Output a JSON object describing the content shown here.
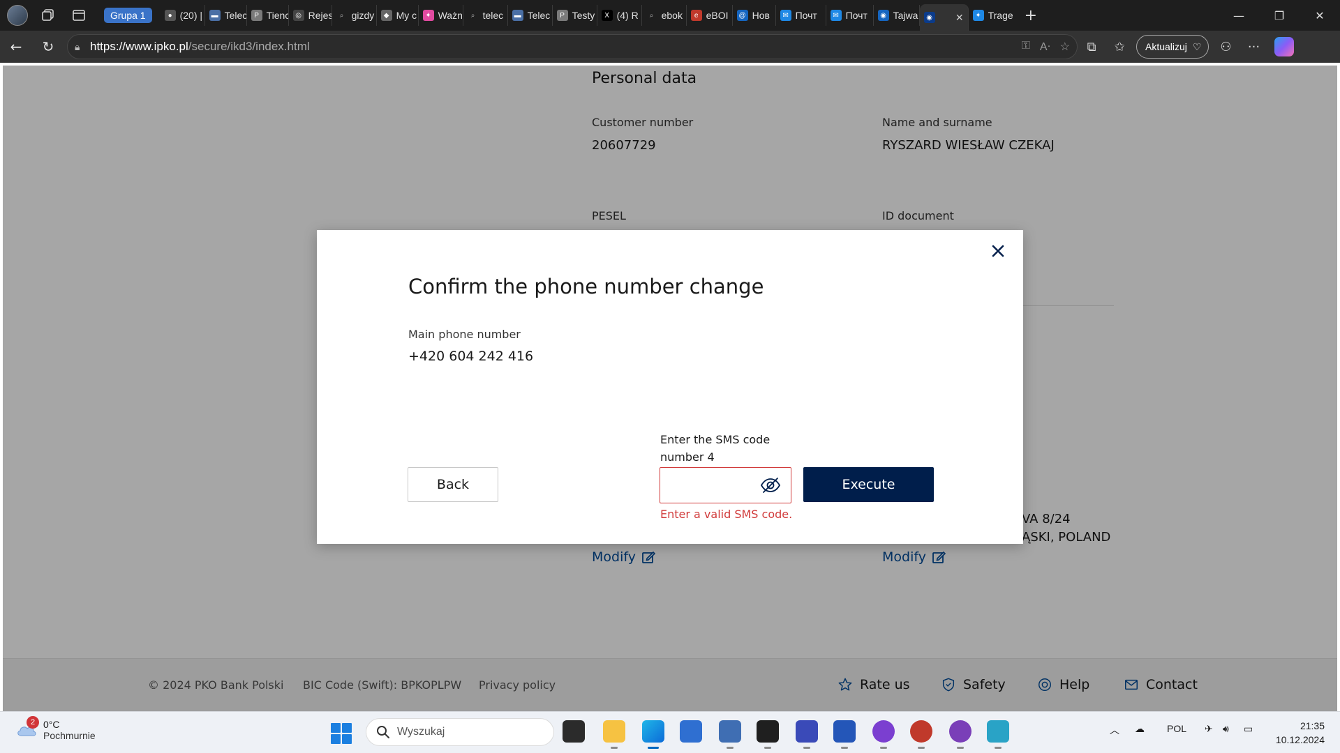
{
  "browser": {
    "profile_icon": "profile-avatar",
    "tab_group_label": "Grupa 1",
    "tabs": [
      {
        "label": "(20) |",
        "icon": "github-icon",
        "color": "#555555"
      },
      {
        "label": "Telec",
        "icon": "telekom-icon",
        "color": "#4a6fa5"
      },
      {
        "label": "Tienc",
        "icon": "p-icon",
        "color": "#7a7a7a"
      },
      {
        "label": "Rejes",
        "icon": "logo-icon",
        "color": "#444444"
      },
      {
        "label": "gizdy",
        "icon": "search-icon",
        "color": "#3a3a3a"
      },
      {
        "label": "My c",
        "icon": "shield-icon",
        "color": "#666666"
      },
      {
        "label": "Ważn",
        "icon": "butterfly-icon",
        "color": "#e14aa0"
      },
      {
        "label": "telec",
        "icon": "search-icon",
        "color": "#3a3a3a"
      },
      {
        "label": "Telec",
        "icon": "telekom-icon",
        "color": "#4a6fa5"
      },
      {
        "label": "Testy",
        "icon": "p-icon",
        "color": "#7a7a7a"
      },
      {
        "label": "(4) R",
        "icon": "x-icon",
        "color": "#000000"
      },
      {
        "label": "ebok",
        "icon": "search-icon",
        "color": "#3a3a3a"
      },
      {
        "label": "eBOI",
        "icon": "orange-swirl-icon",
        "color": "#c0392b"
      },
      {
        "label": "Нов",
        "icon": "at-icon",
        "color": "#1565c0"
      },
      {
        "label": "Почт",
        "icon": "mail-icon",
        "color": "#1e88e5"
      },
      {
        "label": "Почт",
        "icon": "mail-icon",
        "color": "#1e88e5"
      },
      {
        "label": "Tajwa",
        "icon": "pko-icon",
        "color": "#1565c0"
      },
      {
        "label": "",
        "icon": "pko-active-icon",
        "color": "#0b3b8a"
      },
      {
        "label": "Trage",
        "icon": "butterfly-icon",
        "color": "#1e88e5"
      }
    ],
    "url_host": "https://www.ipko.pl",
    "url_path": "/secure/ikd3/index.html",
    "update_label": "Aktualizuj"
  },
  "page": {
    "section_title": "Personal data",
    "customer_number_label": "Customer number",
    "customer_number": "20607729",
    "name_label": "Name and surname",
    "name": "RYSZARD WIESŁAW CZEKAJ",
    "pesel_label": "PESEL",
    "id_document_label": "ID document",
    "partial_value_left": "(+",
    "address_partial_1": "VA 8/24",
    "address_partial_2": "ĄSKI, POLAND",
    "modify_label": "Modify"
  },
  "modal": {
    "title": "Confirm the phone number change",
    "phone_label": "Main phone number",
    "phone_value": "+420 604 242 416",
    "sms_label": "Enter the SMS code number 4",
    "sms_value": "",
    "error_text": "Enter a valid SMS code.",
    "back_label": "Back",
    "execute_label": "Execute"
  },
  "footer": {
    "copyright": "© 2024 PKO Bank Polski",
    "bic": "BIC Code (Swift): BPKOPLPW",
    "privacy": "Privacy policy",
    "rate_us": "Rate us",
    "safety": "Safety",
    "help": "Help",
    "contact": "Contact"
  },
  "taskbar": {
    "weather_badge": "2",
    "temperature": "0°C",
    "condition": "Pochmurnie",
    "search_placeholder": "Wyszukaj",
    "language": "POL",
    "time": "21:35",
    "date": "10.12.2024"
  },
  "colors": {
    "accent_navy": "#001e4b",
    "link_blue": "#004c9a",
    "error_red": "#d13a3a"
  }
}
